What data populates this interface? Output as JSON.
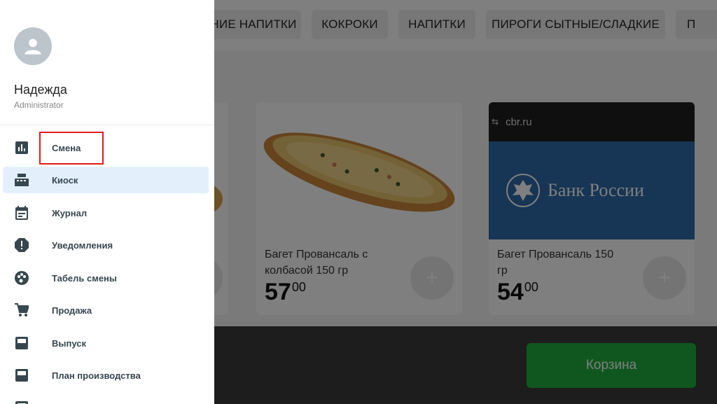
{
  "categories": [
    "НИЕ НАПИТКИ",
    "КОКРОКИ",
    "НАПИТКИ",
    "ПИРОГИ СЫТНЫЕ/СЛАДКИЕ",
    "П"
  ],
  "products": [
    {
      "name": "Багет Провансаль с колбасой 150 гр",
      "price_rub": "57",
      "price_kop": "00"
    },
    {
      "name": "Багет Провансаль 150 гр",
      "price_rub": "54",
      "price_kop": "00"
    }
  ],
  "ad": {
    "domain": "cbr.ru",
    "bank_text": "Банк России"
  },
  "cart": {
    "label": "Корзина"
  },
  "user": {
    "name": "Надежда",
    "role": "Administrator"
  },
  "menu": [
    {
      "label": "Смена",
      "icon": "bar-chart-icon"
    },
    {
      "label": "Киоск",
      "icon": "cash-register-icon",
      "active": true
    },
    {
      "label": "Журнал",
      "icon": "calendar-icon"
    },
    {
      "label": "Уведомления",
      "icon": "alert-icon"
    },
    {
      "label": "Табель смены",
      "icon": "palette-icon"
    },
    {
      "label": "Продажа",
      "icon": "cart-icon"
    },
    {
      "label": "Выпуск",
      "icon": "card-icon"
    },
    {
      "label": "План производства",
      "icon": "card-icon"
    }
  ],
  "colors": {
    "accent_active": "#e3f0fc",
    "highlight": "#e01b1b",
    "cart": "#1fae3e",
    "icon": "#37474f"
  }
}
